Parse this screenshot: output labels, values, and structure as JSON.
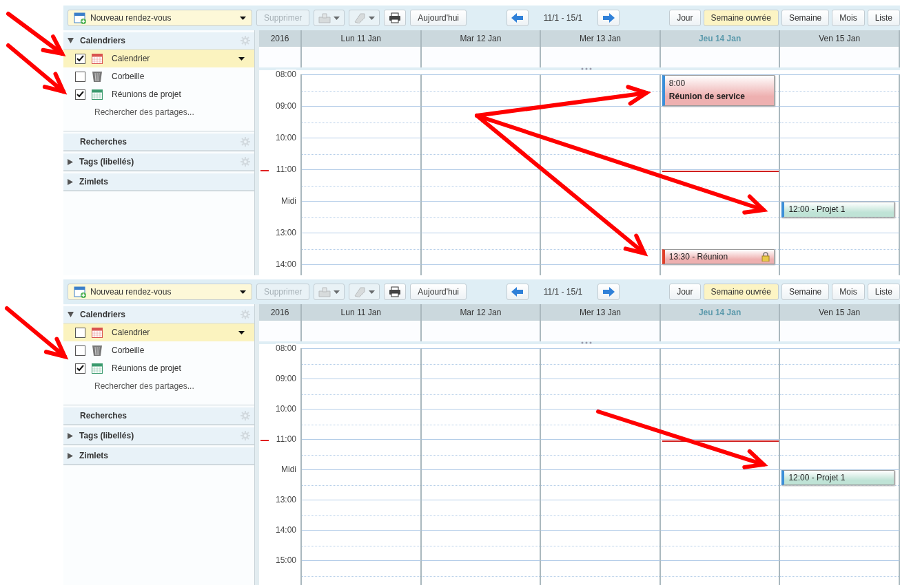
{
  "panels": [
    {
      "toolbar": {
        "new_button": "Nouveau rendez-vous",
        "delete_button": {
          "label": "Supprimer",
          "disabled": true
        },
        "range": "11/1 - 15/1",
        "today_button": "Aujourd'hui",
        "views": [
          {
            "label": "Jour",
            "selected": false
          },
          {
            "label": "Semaine ouvrée",
            "selected": true
          },
          {
            "label": "Semaine",
            "selected": false
          },
          {
            "label": "Mois",
            "selected": false
          },
          {
            "label": "Liste",
            "selected": false
          }
        ]
      },
      "sidebar": [
        {
          "title": "Calendriers",
          "kind": "toggle",
          "expanded": true,
          "settings": true,
          "items": [
            {
              "label": "Calendrier",
              "kind": "calendar",
              "color": "#d9534f",
              "checked": true,
              "selected": true
            },
            {
              "label": "Corbeille",
              "kind": "trash",
              "color": "#777777",
              "checked": false,
              "selected": false
            },
            {
              "label": "Réunions de projet",
              "kind": "calendar",
              "color": "#3a9a6e",
              "checked": true,
              "selected": false
            }
          ],
          "link": "Rechercher des partages..."
        },
        {
          "title": "Recherches",
          "kind": "plain",
          "settings": true
        },
        {
          "title": "Tags (libellés)",
          "kind": "toggle",
          "expanded": false,
          "settings": true
        },
        {
          "title": "Zimlets",
          "kind": "toggle",
          "expanded": false,
          "settings": false
        }
      ],
      "calendar": {
        "year": "2016",
        "days": [
          {
            "label": "Lun 11 Jan",
            "today": false
          },
          {
            "label": "Mar 12 Jan",
            "today": false
          },
          {
            "label": "Mer 13 Jan",
            "today": false
          },
          {
            "label": "Jeu 14 Jan",
            "today": true
          },
          {
            "label": "Ven 15 Jan",
            "today": false
          }
        ],
        "rows": [
          {
            "label": "08:00",
            "now": false,
            "cells": [
              {},
              {},
              {},
              {
                "event": {
                  "kind": "block",
                  "time": "8:00",
                  "title": "Réunion de service",
                  "color": "#eeb0b0",
                  "half": false,
                  "locked": false
                }
              },
              {}
            ]
          },
          {
            "label": "09:00",
            "now": false,
            "cells": [
              {},
              {},
              {},
              {},
              {}
            ]
          },
          {
            "label": "10:00",
            "now": false,
            "cells": [
              {},
              {},
              {},
              {},
              {}
            ]
          },
          {
            "label": "11:00",
            "now": true,
            "cells": [
              {},
              {},
              {},
              {},
              {}
            ]
          },
          {
            "label": "Midi",
            "now": false,
            "cells": [
              {},
              {},
              {},
              {},
              {
                "event": {
                  "kind": "bar",
                  "time": "12:00 - Projet 1",
                  "color": "#bfe3d6",
                  "half": false,
                  "locked": false
                }
              }
            ]
          },
          {
            "label": "13:00",
            "now": false,
            "cells": [
              {},
              {},
              {},
              {
                "event": {
                  "kind": "bar",
                  "time": "13:30 - Réunion",
                  "color": "#eeb0b0",
                  "half": true,
                  "locked": true
                }
              },
              {}
            ]
          },
          {
            "label": "14:00",
            "now": false,
            "cells": [
              {},
              {},
              {},
              {},
              {}
            ]
          }
        ]
      }
    },
    {
      "toolbar": {
        "new_button": "Nouveau rendez-vous",
        "delete_button": {
          "label": "Supprimer",
          "disabled": true
        },
        "range": "11/1 - 15/1",
        "today_button": "Aujourd'hui",
        "views": [
          {
            "label": "Jour",
            "selected": false
          },
          {
            "label": "Semaine ouvrée",
            "selected": true
          },
          {
            "label": "Semaine",
            "selected": false
          },
          {
            "label": "Mois",
            "selected": false
          },
          {
            "label": "Liste",
            "selected": false
          }
        ]
      },
      "sidebar": [
        {
          "title": "Calendriers",
          "kind": "toggle",
          "expanded": true,
          "settings": true,
          "items": [
            {
              "label": "Calendrier",
              "kind": "calendar",
              "color": "#d9534f",
              "checked": false,
              "selected": true
            },
            {
              "label": "Corbeille",
              "kind": "trash",
              "color": "#777777",
              "checked": false,
              "selected": false
            },
            {
              "label": "Réunions de projet",
              "kind": "calendar",
              "color": "#3a9a6e",
              "checked": true,
              "selected": false
            }
          ],
          "link": "Rechercher des partages..."
        },
        {
          "title": "Recherches",
          "kind": "plain",
          "settings": true
        },
        {
          "title": "Tags (libellés)",
          "kind": "toggle",
          "expanded": false,
          "settings": true
        },
        {
          "title": "Zimlets",
          "kind": "toggle",
          "expanded": false,
          "settings": false
        }
      ],
      "calendar": {
        "year": "2016",
        "days": [
          {
            "label": "Lun 11 Jan",
            "today": false
          },
          {
            "label": "Mar 12 Jan",
            "today": false
          },
          {
            "label": "Mer 13 Jan",
            "today": false
          },
          {
            "label": "Jeu 14 Jan",
            "today": true
          },
          {
            "label": "Ven 15 Jan",
            "today": false
          }
        ],
        "rows": [
          {
            "label": "08:00",
            "now": false,
            "cells": [
              {},
              {},
              {},
              {},
              {}
            ]
          },
          {
            "label": "09:00",
            "now": false,
            "cells": [
              {},
              {},
              {},
              {},
              {}
            ]
          },
          {
            "label": "10:00",
            "now": false,
            "cells": [
              {},
              {},
              {},
              {},
              {}
            ]
          },
          {
            "label": "11:00",
            "now": true,
            "cells": [
              {},
              {},
              {},
              {},
              {}
            ]
          },
          {
            "label": "Midi",
            "now": false,
            "cells": [
              {},
              {},
              {},
              {},
              {
                "event": {
                  "kind": "bar",
                  "time": "12:00 - Projet 1",
                  "color": "#bfe3d6",
                  "half": false,
                  "locked": false
                }
              }
            ]
          },
          {
            "label": "13:00",
            "now": false,
            "cells": [
              {},
              {},
              {},
              {},
              {}
            ]
          },
          {
            "label": "14:00",
            "now": false,
            "cells": [
              {},
              {},
              {},
              {},
              {}
            ]
          },
          {
            "label": "15:00",
            "now": false,
            "cells": [
              {},
              {},
              {},
              {},
              {}
            ]
          }
        ]
      }
    }
  ]
}
